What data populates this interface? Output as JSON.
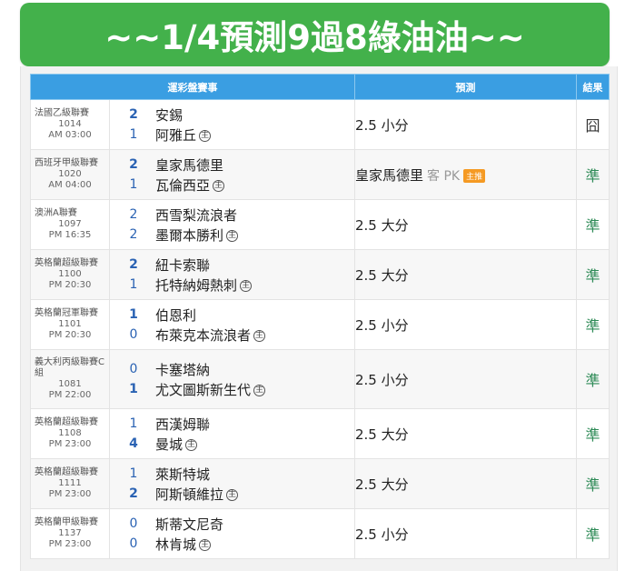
{
  "banner": {
    "title": "~~1/4預測9過8綠油油~~"
  },
  "table": {
    "headers": {
      "match": "運彩盤賽事",
      "prediction": "預測",
      "result": "結果"
    },
    "home_marker": "主",
    "rows": [
      {
        "league": "法國乙級聯賽",
        "code": "1014",
        "time": "AM 03:00",
        "team1": "安錫",
        "score1": "2",
        "team2": "阿雅丘",
        "score2": "1",
        "bold": [
          true,
          false
        ],
        "prediction": "2.5 小分",
        "result": "囧",
        "win": false
      },
      {
        "league": "西班牙甲級聯賽",
        "code": "1020",
        "time": "AM 04:00",
        "team1": "皇家馬德里",
        "score1": "2",
        "team2": "瓦倫西亞",
        "score2": "1",
        "bold": [
          true,
          false
        ],
        "prediction": "皇家馬德里",
        "prediction_extra": "客 PK",
        "prediction_badge": "主推",
        "result": "準",
        "win": true
      },
      {
        "league": "澳洲A聯賽",
        "code": "1097",
        "time": "PM 16:35",
        "team1": "西雪梨流浪者",
        "score1": "2",
        "team2": "墨爾本勝利",
        "score2": "2",
        "bold": [
          false,
          false
        ],
        "prediction": "2.5 大分",
        "result": "準",
        "win": true
      },
      {
        "league": "英格蘭超級聯賽",
        "code": "1100",
        "time": "PM 20:30",
        "team1": "紐卡索聯",
        "score1": "2",
        "team2": "托特納姆熱刺",
        "score2": "1",
        "bold": [
          true,
          false
        ],
        "prediction": "2.5 大分",
        "result": "準",
        "win": true
      },
      {
        "league": "英格蘭冠軍聯賽",
        "code": "1101",
        "time": "PM 20:30",
        "team1": "伯恩利",
        "score1": "1",
        "team2": "布萊克本流浪者",
        "score2": "0",
        "bold": [
          true,
          false
        ],
        "prediction": "2.5 小分",
        "result": "準",
        "win": true
      },
      {
        "league": "義大利丙級聯賽C組",
        "code": "1081",
        "time": "PM 22:00",
        "team1": "卡塞塔納",
        "score1": "0",
        "team2": "尤文圖斯新生代",
        "score2": "1",
        "bold": [
          false,
          true
        ],
        "prediction": "2.5 小分",
        "result": "準",
        "win": true
      },
      {
        "league": "英格蘭超級聯賽",
        "code": "1108",
        "time": "PM 23:00",
        "team1": "西漢姆聯",
        "score1": "1",
        "team2": "曼城",
        "score2": "4",
        "bold": [
          false,
          true
        ],
        "prediction": "2.5 大分",
        "result": "準",
        "win": true
      },
      {
        "league": "英格蘭超級聯賽",
        "code": "1111",
        "time": "PM 23:00",
        "team1": "萊斯特城",
        "score1": "1",
        "team2": "阿斯頓維拉",
        "score2": "2",
        "bold": [
          false,
          true
        ],
        "prediction": "2.5 大分",
        "result": "準",
        "win": true
      },
      {
        "league": "英格蘭甲級聯賽",
        "code": "1137",
        "time": "PM 23:00",
        "team1": "斯蒂文尼奇",
        "score1": "0",
        "team2": "林肯城",
        "score2": "0",
        "bold": [
          false,
          false
        ],
        "prediction": "2.5 小分",
        "result": "準",
        "win": true
      }
    ]
  }
}
